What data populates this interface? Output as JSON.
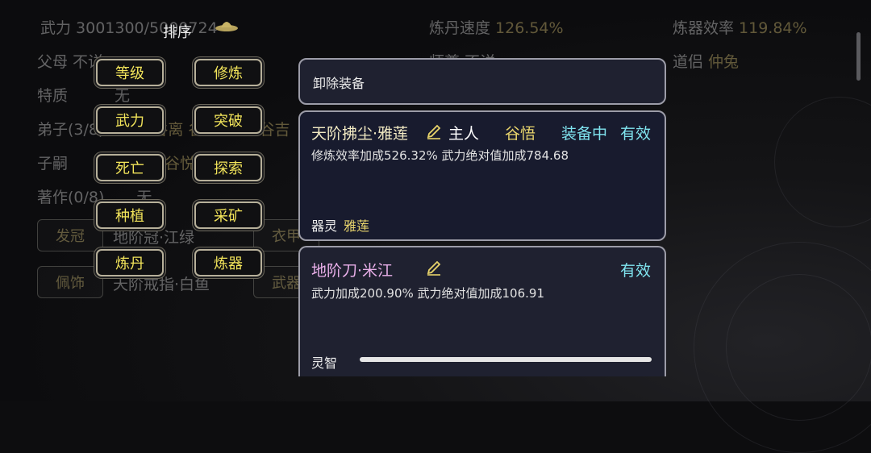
{
  "bg_stats": {
    "force_label": "武力",
    "force_value": "3001300/5000724",
    "dan_speed_label": "炼丹速度",
    "dan_speed_value": "126.54%",
    "craft_eff_label": "炼器效率",
    "craft_eff_value": "119.84%",
    "parents_label": "父母",
    "parents_value": "不详",
    "master_label": "师尊",
    "master_value": "不详",
    "partner_label": "道侣",
    "partner_value": "仲兔",
    "trait_label": "特质",
    "trait_value": "无",
    "disciples_label": "弟子(3/8)",
    "disciples_value": "谷离 谷战 谷悦 谷吉",
    "heirs_label": "子嗣",
    "heirs_value": "谷离 谷悦 谷战",
    "works_label": "著作(0/8)",
    "works_value": "无"
  },
  "bg_slots": {
    "crown_label": "发冠",
    "crown_value": "地阶冠·江绿",
    "clothes_label": "衣甲",
    "accessory_label": "佩饰",
    "accessory_value": "天阶戒指·白鱼",
    "weapon_label": "武器"
  },
  "sort": {
    "title": "排序",
    "buttons": [
      "等级",
      "修炼",
      "武力",
      "突破",
      "死亡",
      "探索",
      "种植",
      "采矿",
      "炼丹",
      "炼器"
    ]
  },
  "panel": {
    "unequip_label": "卸除装备",
    "item1": {
      "name": "天阶拂尘·雅莲",
      "owner": "主人",
      "owner_name": "谷悟",
      "status": "装备中",
      "valid": "有效",
      "effect": "修炼效率加成526.32% 武力绝对值加成784.68",
      "spirit_label": "器灵",
      "spirit_name": "雅莲"
    },
    "item2": {
      "name": "地阶刀·米江",
      "valid": "有效",
      "effect": "武力加成200.90% 武力绝对值加成106.91",
      "wisdom_label": "灵智",
      "wisdom_level": 1.0
    }
  },
  "icons": {
    "edit": "pencil-icon",
    "hat": "hat-icon"
  },
  "colors": {
    "gold": "#d6c074",
    "yellow_btn": "#f2e45a",
    "item1_name": "#f1e9c2",
    "item2_name": "#eab0ea",
    "status_cyan": "#7fe3ee"
  }
}
